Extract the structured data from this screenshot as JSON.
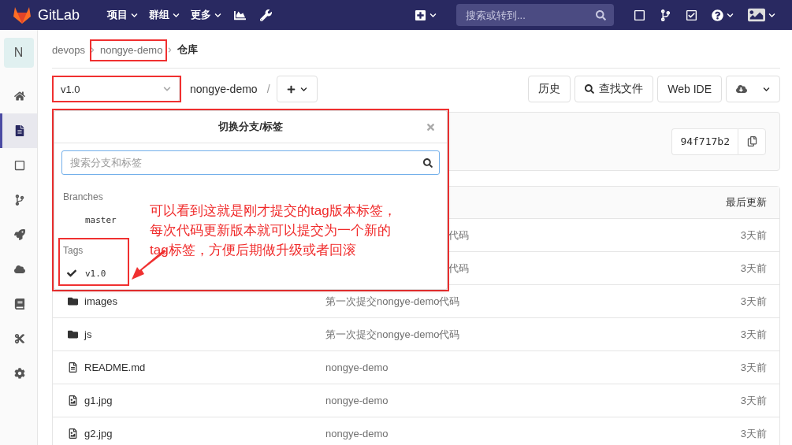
{
  "navbar": {
    "brand": "GitLab",
    "menus": [
      {
        "label": "项目"
      },
      {
        "label": "群组"
      },
      {
        "label": "更多"
      }
    ],
    "search": {
      "placeholder": "搜索或转到..."
    }
  },
  "sidebar": {
    "avatar": "N",
    "items": [
      {
        "kind": "home",
        "selected": false
      },
      {
        "kind": "repository",
        "selected": true
      },
      {
        "kind": "issues",
        "selected": false
      },
      {
        "kind": "merge_requests",
        "selected": false
      },
      {
        "kind": "ci",
        "selected": false
      },
      {
        "kind": "operations",
        "selected": false
      },
      {
        "kind": "wiki",
        "selected": false
      },
      {
        "kind": "snippets",
        "selected": false
      },
      {
        "kind": "settings",
        "selected": false
      }
    ]
  },
  "breadcrumb": [
    "devops",
    "nongye-demo",
    "仓库"
  ],
  "toolbar": {
    "ref": "v1.0",
    "path": "nongye-demo",
    "separator": "/",
    "buttons": [
      "历史",
      "查找文件",
      "Web IDE"
    ]
  },
  "commit": {
    "sha": "94f717b2"
  },
  "files": {
    "header": "最后更新",
    "rows": [
      {
        "kind": "covered",
        "message": "代码",
        "updated": "3天前"
      },
      {
        "kind": "covered",
        "message": "代码",
        "updated": "3天前"
      },
      {
        "kind": "folder",
        "name": "images",
        "message": "第一次提交nongye-demo代码",
        "updated": "3天前"
      },
      {
        "kind": "folder",
        "name": "js",
        "message": "第一次提交nongye-demo代码",
        "updated": "3天前"
      },
      {
        "kind": "file",
        "name": "README.md",
        "message": "nongye-demo",
        "updated": "3天前"
      },
      {
        "kind": "image",
        "name": "g1.jpg",
        "message": "nongye-demo",
        "updated": "3天前"
      },
      {
        "kind": "image",
        "name": "g2.jpg",
        "message": "nongye-demo",
        "updated": "3天前"
      }
    ]
  },
  "ref_dropdown": {
    "title": "切换分支/标签",
    "search": {
      "placeholder": "搜索分支和标签"
    },
    "sections": [
      {
        "heading": "Branches",
        "items": [
          {
            "label": "master",
            "selected": false
          }
        ]
      },
      {
        "heading": "Tags",
        "items": [
          {
            "label": "v1.0",
            "selected": true
          }
        ]
      }
    ]
  },
  "annotation": {
    "lines": [
      "可以看到这就是刚才提交的tag版本标签，",
      "每次代码更新版本就可以提交为一个新的",
      "tag标签，方便后期做升级或者回滚"
    ]
  }
}
